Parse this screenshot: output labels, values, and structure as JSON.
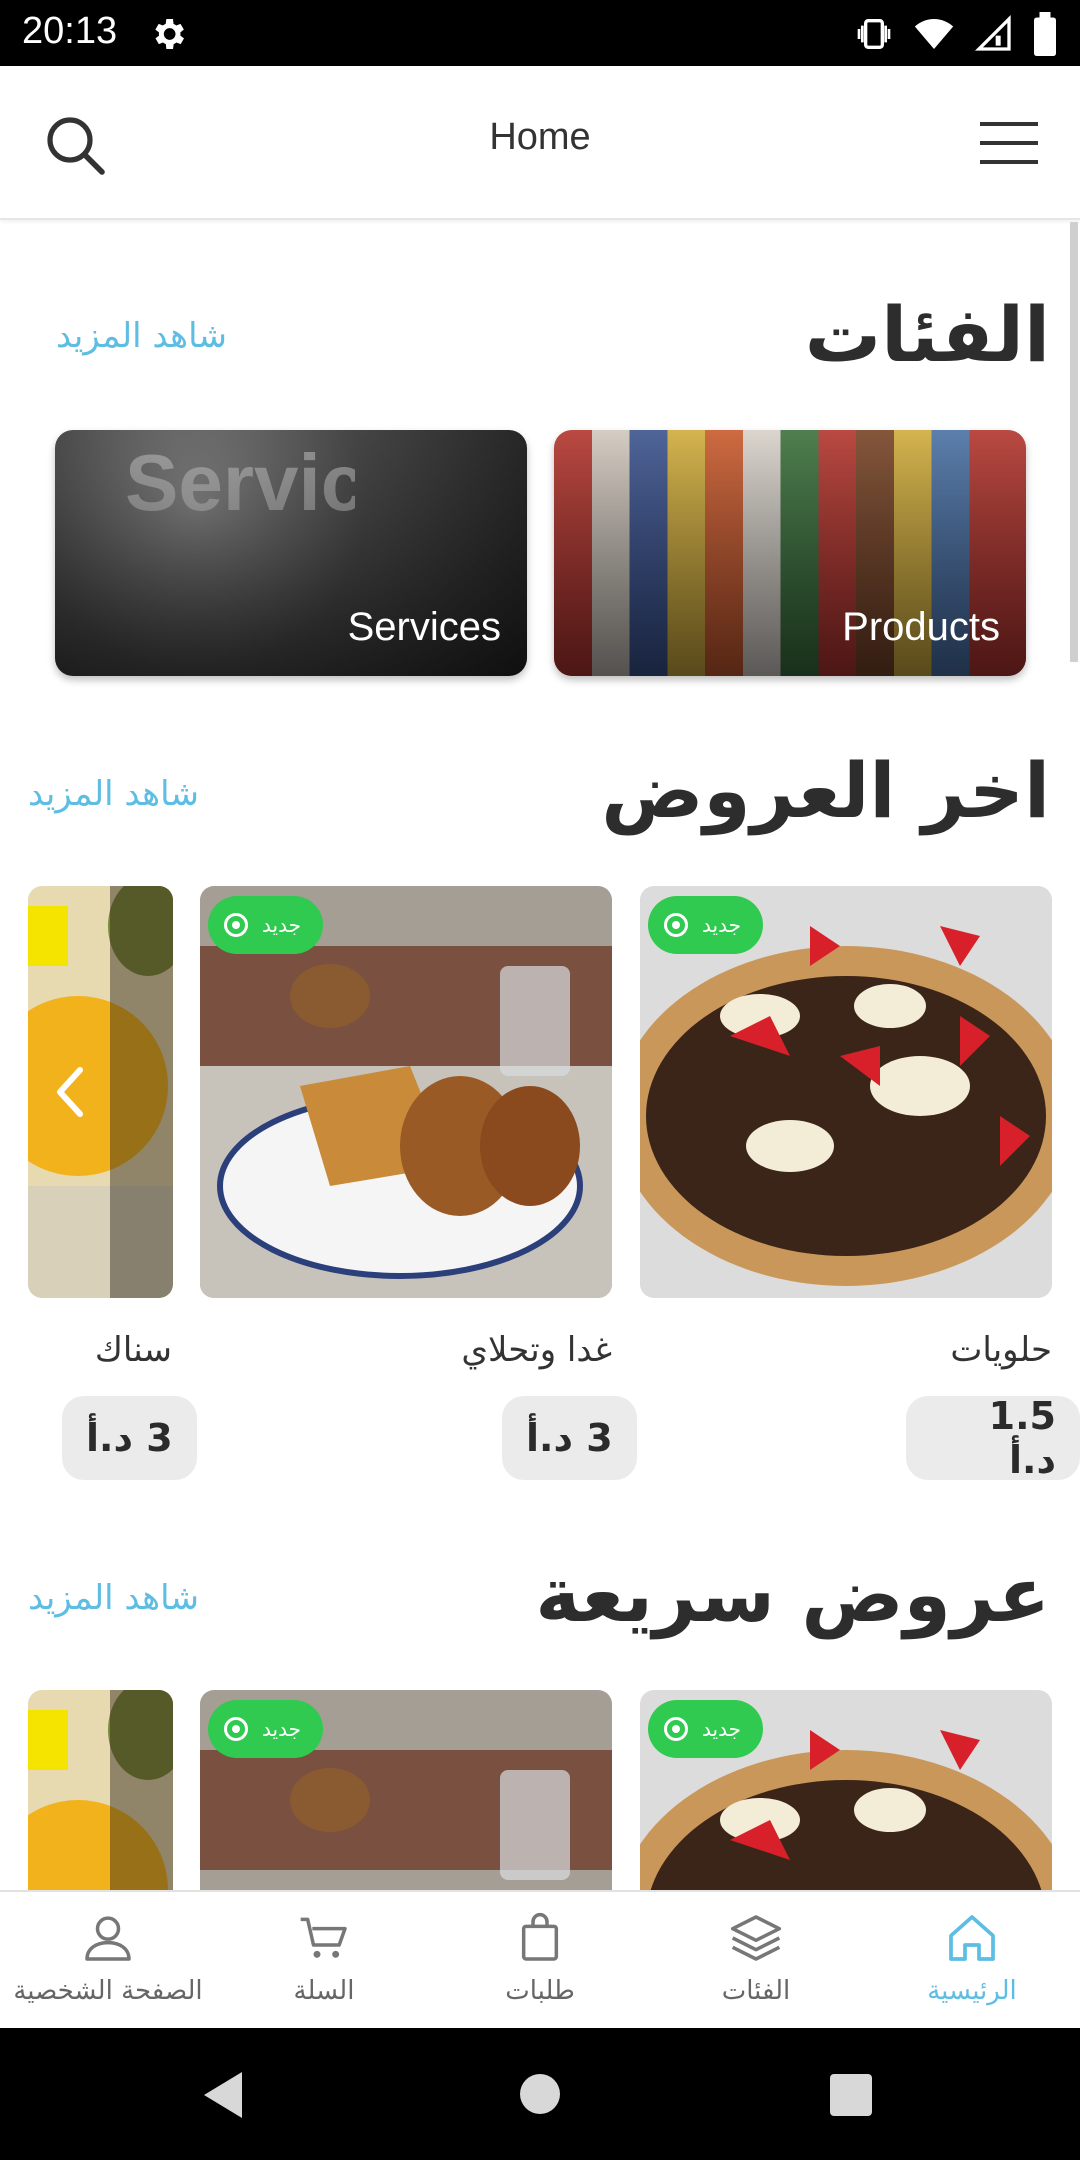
{
  "status_bar": {
    "time": "20:13"
  },
  "header": {
    "title": "Home"
  },
  "categories_section": {
    "title": "الفئات",
    "see_more": "شاهد المزيد",
    "items": [
      {
        "label": "Products"
      },
      {
        "label": "Services"
      }
    ]
  },
  "latest_offers": {
    "title": "اخر العروض",
    "see_more": "شاهد المزيد",
    "items": [
      {
        "name": "حلويات",
        "price": "1.5 د.أ",
        "badge": "جديد"
      },
      {
        "name": "غدا وتحلاي",
        "price": "3 د.أ",
        "badge": "جديد"
      },
      {
        "name": "سناك",
        "price": "3 د.أ"
      }
    ]
  },
  "quick_offers": {
    "title": "عروض سريعة",
    "see_more": "شاهد المزيد",
    "items": [
      {
        "badge": "جديد"
      },
      {
        "badge": "جديد"
      }
    ]
  },
  "bottom_nav": {
    "items": [
      {
        "label": "الرئيسية",
        "icon": "home-icon",
        "active": true
      },
      {
        "label": "الفئات",
        "icon": "layers-icon"
      },
      {
        "label": "طلبات",
        "icon": "bag-icon"
      },
      {
        "label": "السلة",
        "icon": "cart-icon"
      },
      {
        "label": "الصفحة الشخصية",
        "icon": "user-icon"
      }
    ]
  },
  "colors": {
    "accent": "#5dbde3",
    "badge": "#2fca4f",
    "price_bg": "#ebebeb"
  }
}
